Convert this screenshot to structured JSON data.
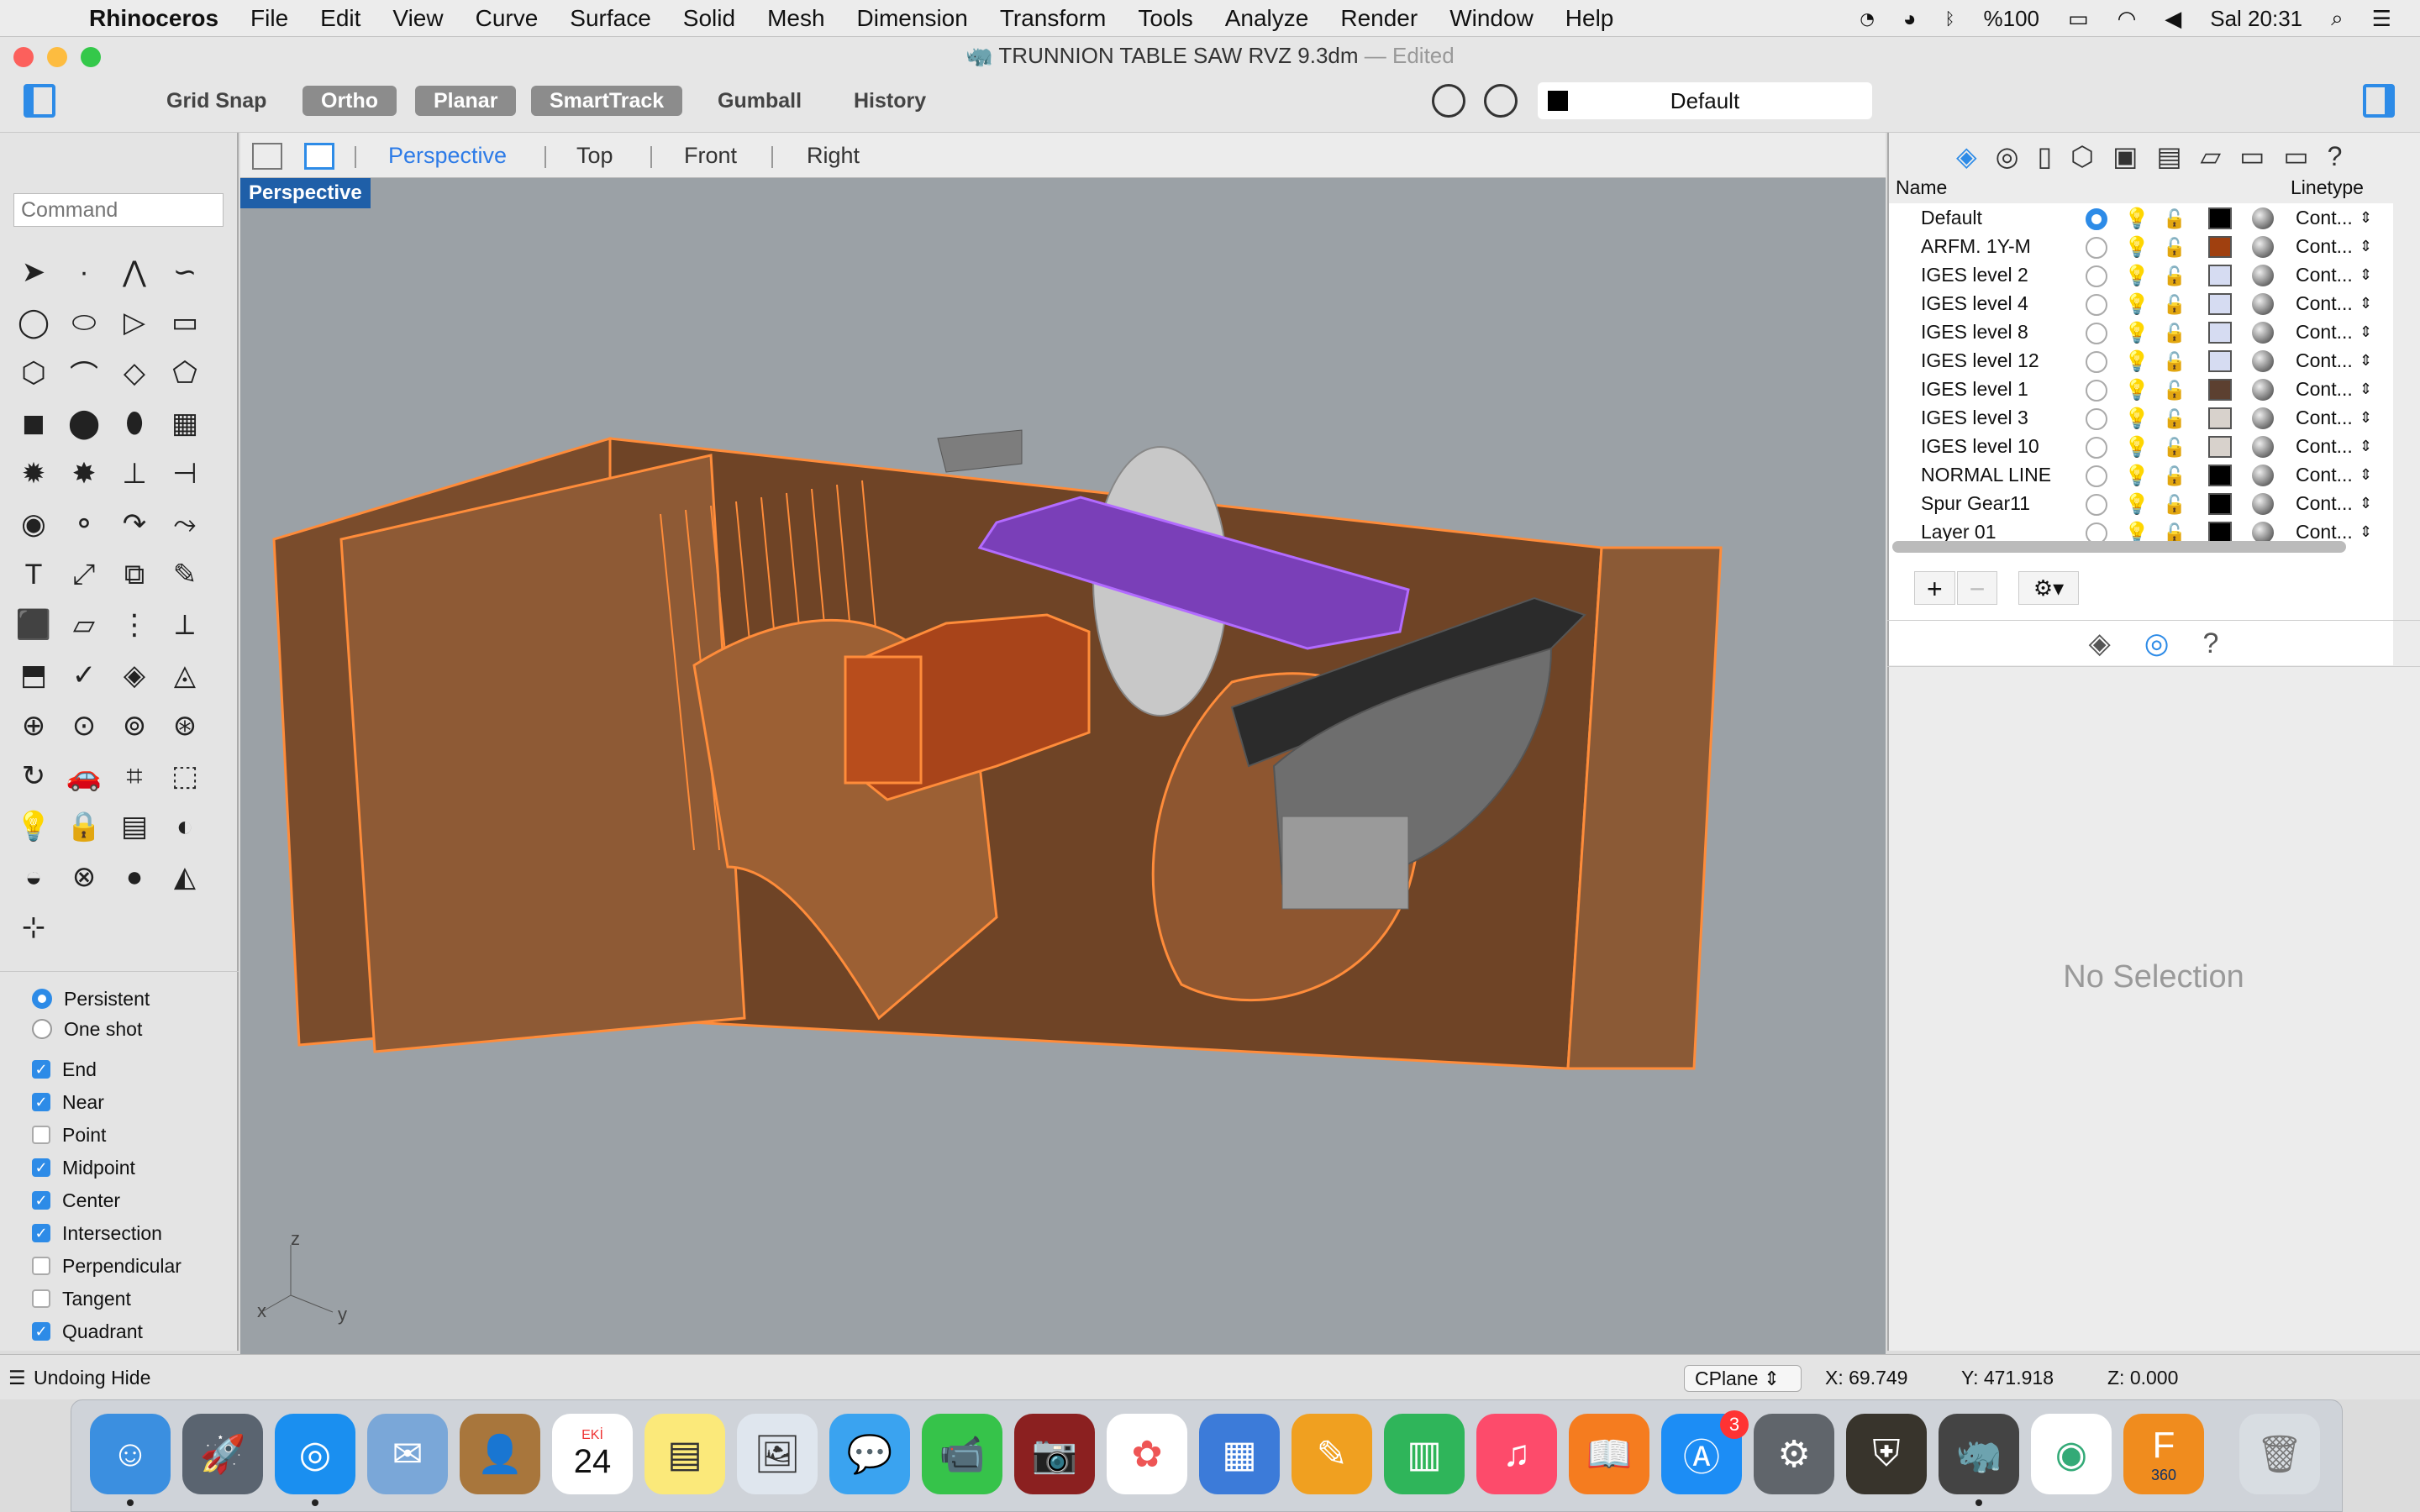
{
  "menubar": {
    "app": "Rhinoceros",
    "items": [
      "File",
      "Edit",
      "View",
      "Curve",
      "Surface",
      "Solid",
      "Mesh",
      "Dimension",
      "Transform",
      "Tools",
      "Analyze",
      "Render",
      "Window",
      "Help"
    ],
    "battery": "%100",
    "clock": "Sal 20:31"
  },
  "window": {
    "title": "TRUNNION TABLE SAW RVZ 9.3dm",
    "edited": "— Edited"
  },
  "toolbar": {
    "grid_snap": "Grid Snap",
    "ortho": "Ortho",
    "planar": "Planar",
    "smarttrack": "SmartTrack",
    "gumball": "Gumball",
    "history": "History",
    "current_layer": "Default"
  },
  "left": {
    "command_placeholder": "Command",
    "osnap": {
      "persistent": "Persistent",
      "one_shot": "One shot",
      "items": [
        {
          "label": "End",
          "checked": true
        },
        {
          "label": "Near",
          "checked": true
        },
        {
          "label": "Point",
          "checked": false
        },
        {
          "label": "Midpoint",
          "checked": true
        },
        {
          "label": "Center",
          "checked": true
        },
        {
          "label": "Intersection",
          "checked": true
        },
        {
          "label": "Perpendicular",
          "checked": false
        },
        {
          "label": "Tangent",
          "checked": false
        },
        {
          "label": "Quadrant",
          "checked": true
        }
      ]
    }
  },
  "viewport": {
    "tabs": [
      "Perspective",
      "Top",
      "Front",
      "Right"
    ],
    "active": "Perspective",
    "label": "Perspective",
    "axis_z": "z",
    "axis_x": "x",
    "axis_y": "y"
  },
  "layers": {
    "col_name": "Name",
    "col_linetype": "Linetype",
    "rows": [
      {
        "name": "Default",
        "current": true,
        "color": "#000000",
        "linetype": "Cont..."
      },
      {
        "name": "ARFM. 1Y-M",
        "current": false,
        "color": "#a0400f",
        "linetype": "Cont..."
      },
      {
        "name": "IGES level 2",
        "current": false,
        "color": "#d6dcf2",
        "linetype": "Cont..."
      },
      {
        "name": "IGES level 4",
        "current": false,
        "color": "#d6dcf2",
        "linetype": "Cont..."
      },
      {
        "name": "IGES level 8",
        "current": false,
        "color": "#d6dcf2",
        "linetype": "Cont..."
      },
      {
        "name": "IGES level 12",
        "current": false,
        "color": "#d6dcf2",
        "linetype": "Cont..."
      },
      {
        "name": "IGES level 1",
        "current": false,
        "color": "#5c4030",
        "linetype": "Cont..."
      },
      {
        "name": "IGES level 3",
        "current": false,
        "color": "#d8d2cc",
        "linetype": "Cont..."
      },
      {
        "name": "IGES level 10",
        "current": false,
        "color": "#d8d2cc",
        "linetype": "Cont..."
      },
      {
        "name": "NORMAL LINE",
        "current": false,
        "color": "#000000",
        "linetype": "Cont..."
      },
      {
        "name": "Spur Gear11",
        "current": false,
        "color": "#000000",
        "linetype": "Cont..."
      },
      {
        "name": "Layer 01",
        "current": false,
        "color": "#000000",
        "linetype": "Cont..."
      }
    ]
  },
  "properties": {
    "no_selection": "No Selection"
  },
  "status": {
    "message": "Undoing Hide",
    "cplane": "CPlane",
    "x": "X: 69.749",
    "y": "Y: 471.918",
    "z": "Z: 0.000"
  },
  "dock": {
    "calendar_month": "EKİ",
    "calendar_day": "24",
    "appstore_badge": "3",
    "fusion_label": "360"
  }
}
